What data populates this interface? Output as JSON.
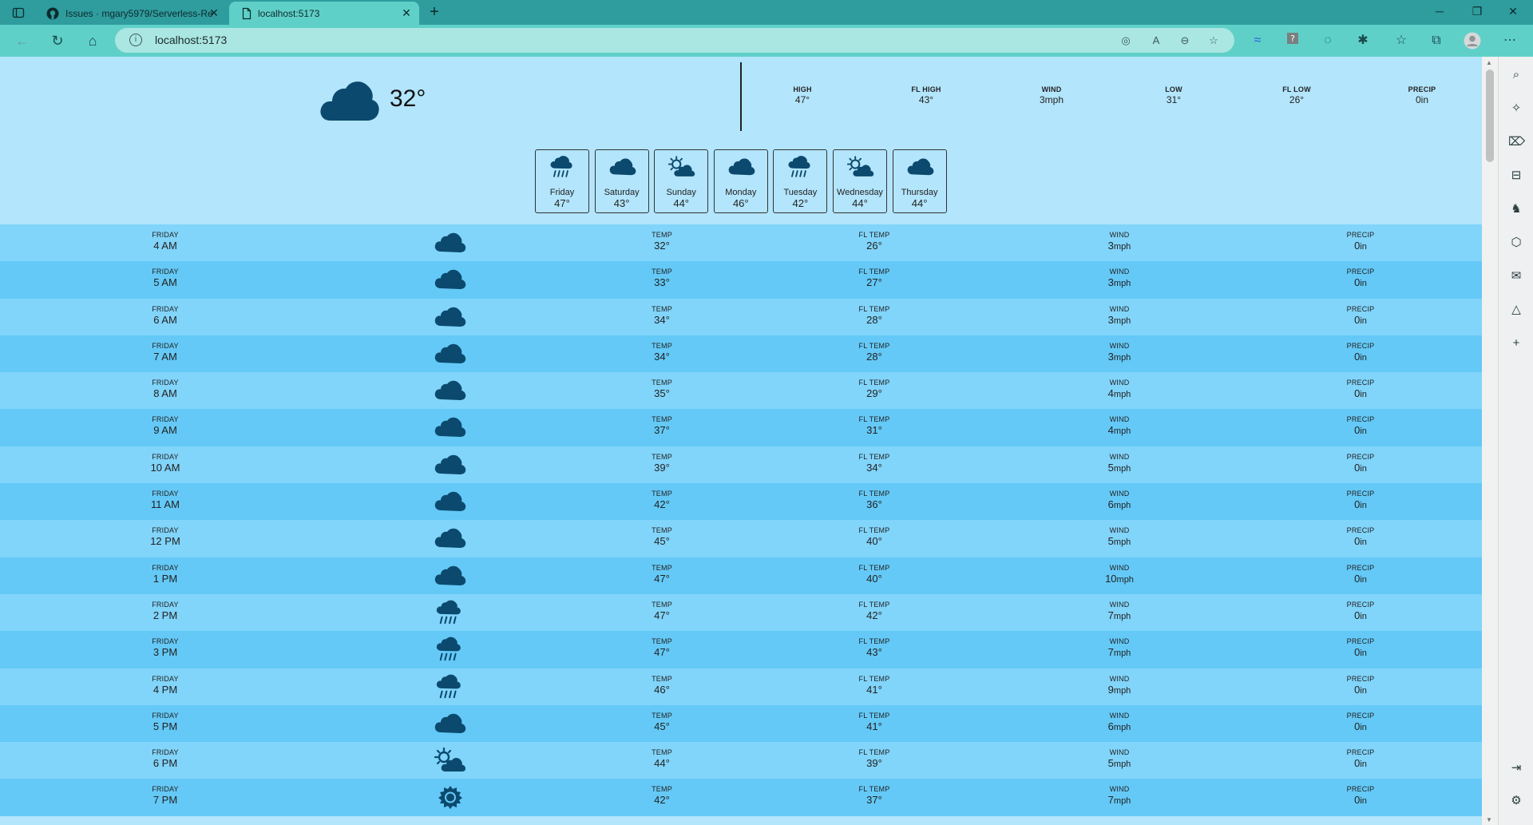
{
  "browser": {
    "tabs": [
      {
        "title": "Issues · mgary5979/Serverless-Re",
        "icon": "github-icon"
      },
      {
        "title": "localhost:5173",
        "icon": "page-icon"
      }
    ],
    "url": "localhost:5173",
    "window_controls": [
      "minimize",
      "restore",
      "close"
    ]
  },
  "current": {
    "icon": "cloud-icon",
    "temp": "32°"
  },
  "stats": [
    {
      "label": "HIGH",
      "value": "47°"
    },
    {
      "label": "FL HIGH",
      "value": "43°"
    },
    {
      "label": "WIND",
      "value": "3mph"
    },
    {
      "label": "LOW",
      "value": "31°"
    },
    {
      "label": "FL LOW",
      "value": "26°"
    },
    {
      "label": "PRECIP",
      "value": "0in"
    }
  ],
  "daily": [
    {
      "day": "Friday",
      "temp": "47°",
      "icon": "rain"
    },
    {
      "day": "Saturday",
      "temp": "43°",
      "icon": "cloud"
    },
    {
      "day": "Sunday",
      "temp": "44°",
      "icon": "partly"
    },
    {
      "day": "Monday",
      "temp": "46°",
      "icon": "cloud"
    },
    {
      "day": "Tuesday",
      "temp": "42°",
      "icon": "rain"
    },
    {
      "day": "Wednesday",
      "temp": "44°",
      "icon": "partly"
    },
    {
      "day": "Thursday",
      "temp": "44°",
      "icon": "cloud"
    }
  ],
  "hourly_labels": {
    "temp": "TEMP",
    "fl_temp": "FL TEMP",
    "wind": "WIND",
    "precip": "PRECIP"
  },
  "hourly": [
    {
      "day": "FRIDAY",
      "time": "4 AM",
      "icon": "cloud",
      "temp": "32°",
      "fl": "26°",
      "wind": "3",
      "precip": "0"
    },
    {
      "day": "FRIDAY",
      "time": "5 AM",
      "icon": "cloud",
      "temp": "33°",
      "fl": "27°",
      "wind": "3",
      "precip": "0"
    },
    {
      "day": "FRIDAY",
      "time": "6 AM",
      "icon": "cloud",
      "temp": "34°",
      "fl": "28°",
      "wind": "3",
      "precip": "0"
    },
    {
      "day": "FRIDAY",
      "time": "7 AM",
      "icon": "cloud",
      "temp": "34°",
      "fl": "28°",
      "wind": "3",
      "precip": "0"
    },
    {
      "day": "FRIDAY",
      "time": "8 AM",
      "icon": "cloud",
      "temp": "35°",
      "fl": "29°",
      "wind": "4",
      "precip": "0"
    },
    {
      "day": "FRIDAY",
      "time": "9 AM",
      "icon": "cloud",
      "temp": "37°",
      "fl": "31°",
      "wind": "4",
      "precip": "0"
    },
    {
      "day": "FRIDAY",
      "time": "10 AM",
      "icon": "cloud",
      "temp": "39°",
      "fl": "34°",
      "wind": "5",
      "precip": "0"
    },
    {
      "day": "FRIDAY",
      "time": "11 AM",
      "icon": "cloud",
      "temp": "42°",
      "fl": "36°",
      "wind": "6",
      "precip": "0"
    },
    {
      "day": "FRIDAY",
      "time": "12 PM",
      "icon": "cloud",
      "temp": "45°",
      "fl": "40°",
      "wind": "5",
      "precip": "0"
    },
    {
      "day": "FRIDAY",
      "time": "1 PM",
      "icon": "cloud",
      "temp": "47°",
      "fl": "40°",
      "wind": "10",
      "precip": "0"
    },
    {
      "day": "FRIDAY",
      "time": "2 PM",
      "icon": "rain",
      "temp": "47°",
      "fl": "42°",
      "wind": "7",
      "precip": "0"
    },
    {
      "day": "FRIDAY",
      "time": "3 PM",
      "icon": "rain",
      "temp": "47°",
      "fl": "43°",
      "wind": "7",
      "precip": "0"
    },
    {
      "day": "FRIDAY",
      "time": "4 PM",
      "icon": "rain",
      "temp": "46°",
      "fl": "41°",
      "wind": "9",
      "precip": "0"
    },
    {
      "day": "FRIDAY",
      "time": "5 PM",
      "icon": "cloud",
      "temp": "45°",
      "fl": "41°",
      "wind": "6",
      "precip": "0"
    },
    {
      "day": "FRIDAY",
      "time": "6 PM",
      "icon": "partly",
      "temp": "44°",
      "fl": "39°",
      "wind": "5",
      "precip": "0"
    },
    {
      "day": "FRIDAY",
      "time": "7 PM",
      "icon": "sun",
      "temp": "42°",
      "fl": "37°",
      "wind": "7",
      "precip": "0"
    }
  ],
  "units": {
    "wind": "mph",
    "precip": "in"
  },
  "colors": {
    "tabbar": "#2f9c9e",
    "toolbar": "#5fd0c8",
    "page_bg": "#b3e5fc",
    "row_a": "#81d4fa",
    "row_b": "#64c9f7",
    "icon": "#0b4a6e"
  }
}
